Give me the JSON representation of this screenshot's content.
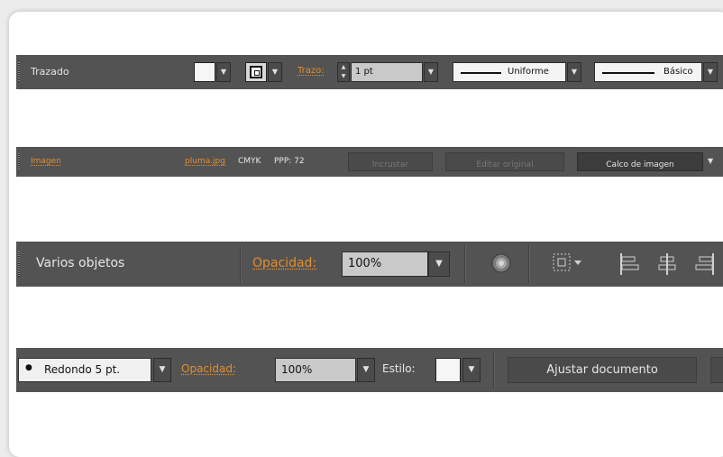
{
  "bar1": {
    "title": "Trazado",
    "stroke_label": "Trazo:",
    "stroke_weight": "1 pt",
    "profile": "Uniforme",
    "brush": "Básico",
    "arrow": "▼",
    "spinner_up": "▲",
    "spinner_down": "▼"
  },
  "bar2": {
    "title": "Imagen",
    "filename": "pluma.jpg",
    "mode": "CMYK",
    "ppi": "PPP: 72",
    "embed_label": "Incrustar",
    "edit_original_label": "Editar original",
    "trace_label": "Calco de imagen",
    "arrow": "▼"
  },
  "bar3": {
    "title": "Varios objetos",
    "opacity_label": "Opacidad:",
    "opacity_value": "100%",
    "arrow": "▼"
  },
  "bar4": {
    "brush_bullet": "●",
    "brush_value": "Redondo 5 pt.",
    "opacity_label": "Opacidad:",
    "opacity_value": "100%",
    "style_label": "Estilo:",
    "fit_label": "Ajustar documento",
    "arrow": "▼"
  },
  "colors": {
    "panel": "#535353",
    "label_orange": "#e38e2c",
    "label_white": "#e6e6e6",
    "field": "#c9c9c9"
  }
}
